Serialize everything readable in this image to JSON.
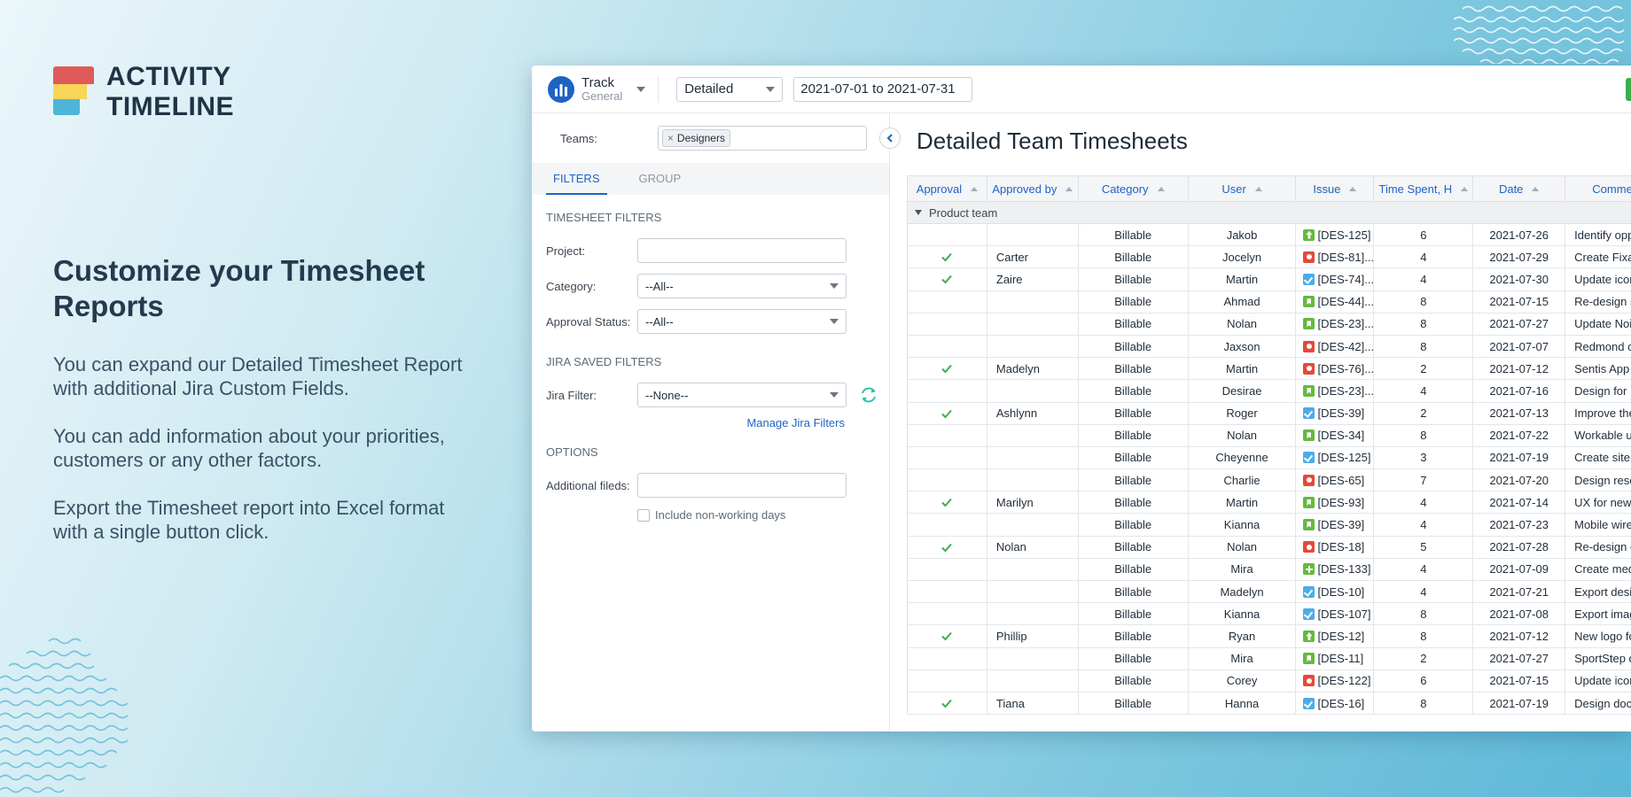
{
  "brand": {
    "line1": "ACTIVITY",
    "line2": "TIMELINE"
  },
  "headline": "Customize your Timesheet Reports",
  "paragraphs": [
    "You can expand our Detailed Timesheet Report with additional Jira Custom Fields.",
    "You can add information about your priorities, customers or any other factors.",
    "Export the Timesheet report into Excel format with a single button click."
  ],
  "app": {
    "track_title": "Track",
    "track_subtitle": "General",
    "view_select": "Detailed",
    "date_range": "2021-07-01 to 2021-07-31"
  },
  "sidebar": {
    "teams_label": "Teams:",
    "teams_chip": "Designers",
    "chip_remove": "×",
    "tabs": [
      "FILTERS",
      "GROUP"
    ],
    "timesheet_filters_title": "TIMESHEET FILTERS",
    "project_label": "Project:",
    "category_label": "Category:",
    "category_value": "--All--",
    "approval_label": "Approval Status:",
    "approval_value": "--All--",
    "jira_saved_filters_title": "JIRA SAVED FILTERS",
    "jira_filter_label": "Jira Filter:",
    "jira_filter_value": "--None--",
    "manage_link": "Manage Jira Filters",
    "options_title": "OPTIONS",
    "additional_label": "Additional fileds:",
    "include_label": "Include non-working days"
  },
  "main": {
    "title": "Detailed Team Timesheets",
    "columns": [
      "Approval",
      "Approved by",
      "Category",
      "User",
      "Issue",
      "Time Spent, H",
      "Date",
      "Comme"
    ],
    "group_name": "Product team",
    "rows": [
      {
        "approved": false,
        "by": "",
        "cat": "Billable",
        "user": "Jakob",
        "type": "improvement",
        "issue": "[DES-125]",
        "time": "6",
        "date": "2021-07-26",
        "comment": "Identify opp"
      },
      {
        "approved": true,
        "by": "Carter",
        "cat": "Billable",
        "user": "Jocelyn",
        "type": "bug",
        "issue": "[DES-81]...",
        "time": "4",
        "date": "2021-07-29",
        "comment": "Create Fixa w"
      },
      {
        "approved": true,
        "by": "Zaire",
        "cat": "Billable",
        "user": "Martin",
        "type": "task",
        "issue": "[DES-74]...",
        "time": "4",
        "date": "2021-07-30",
        "comment": "Update icon"
      },
      {
        "approved": false,
        "by": "",
        "cat": "Billable",
        "user": "Ahmad",
        "type": "story",
        "issue": "[DES-44]...",
        "time": "8",
        "date": "2021-07-15",
        "comment": "Re-design sc"
      },
      {
        "approved": false,
        "by": "",
        "cat": "Billable",
        "user": "Nolan",
        "type": "story",
        "issue": "[DES-23]...",
        "time": "8",
        "date": "2021-07-27",
        "comment": "Update Noiz"
      },
      {
        "approved": false,
        "by": "",
        "cat": "Billable",
        "user": "Jaxson",
        "type": "bug",
        "issue": "[DES-42]...",
        "time": "8",
        "date": "2021-07-07",
        "comment": "Redmond co"
      },
      {
        "approved": true,
        "by": "Madelyn",
        "cat": "Billable",
        "user": "Martin",
        "type": "bug",
        "issue": "[DES-76]...",
        "time": "2",
        "date": "2021-07-12",
        "comment": "Sentis App d"
      },
      {
        "approved": false,
        "by": "",
        "cat": "Billable",
        "user": "Desirae",
        "type": "story",
        "issue": "[DES-23]...",
        "time": "4",
        "date": "2021-07-16",
        "comment": "Design for N"
      },
      {
        "approved": true,
        "by": "Ashlynn",
        "cat": "Billable",
        "user": "Roger",
        "type": "task",
        "issue": "[DES-39]",
        "time": "2",
        "date": "2021-07-13",
        "comment": "Improve the"
      },
      {
        "approved": false,
        "by": "",
        "cat": "Billable",
        "user": "Nolan",
        "type": "story",
        "issue": "[DES-34]",
        "time": "8",
        "date": "2021-07-22",
        "comment": "Workable us"
      },
      {
        "approved": false,
        "by": "",
        "cat": "Billable",
        "user": "Cheyenne",
        "type": "task",
        "issue": "[DES-125]",
        "time": "3",
        "date": "2021-07-19",
        "comment": "Create siten"
      },
      {
        "approved": false,
        "by": "",
        "cat": "Billable",
        "user": "Charlie",
        "type": "bug",
        "issue": "[DES-65]",
        "time": "7",
        "date": "2021-07-20",
        "comment": "Design reser"
      },
      {
        "approved": true,
        "by": "Marilyn",
        "cat": "Billable",
        "user": "Martin",
        "type": "story",
        "issue": "[DES-93]",
        "time": "4",
        "date": "2021-07-14",
        "comment": "UX for new c"
      },
      {
        "approved": false,
        "by": "",
        "cat": "Billable",
        "user": "Kianna",
        "type": "story",
        "issue": "[DES-39]",
        "time": "4",
        "date": "2021-07-23",
        "comment": "Mobile wiref"
      },
      {
        "approved": true,
        "by": "Nolan",
        "cat": "Billable",
        "user": "Nolan",
        "type": "bug",
        "issue": "[DES-18]",
        "time": "5",
        "date": "2021-07-28",
        "comment": "Re-design co"
      },
      {
        "approved": false,
        "by": "",
        "cat": "Billable",
        "user": "Mira",
        "type": "newfeature",
        "issue": "[DES-133]",
        "time": "4",
        "date": "2021-07-09",
        "comment": "Create medi"
      },
      {
        "approved": false,
        "by": "",
        "cat": "Billable",
        "user": "Madelyn",
        "type": "task",
        "issue": "[DES-10]",
        "time": "4",
        "date": "2021-07-21",
        "comment": "Export desig"
      },
      {
        "approved": false,
        "by": "",
        "cat": "Billable",
        "user": "Kianna",
        "type": "task",
        "issue": "[DES-107]",
        "time": "8",
        "date": "2021-07-08",
        "comment": "Export imag"
      },
      {
        "approved": true,
        "by": "Phillip",
        "cat": "Billable",
        "user": "Ryan",
        "type": "improvement",
        "issue": "[DES-12]",
        "time": "8",
        "date": "2021-07-12",
        "comment": "New logo fo"
      },
      {
        "approved": false,
        "by": "",
        "cat": "Billable",
        "user": "Mira",
        "type": "story",
        "issue": "[DES-11]",
        "time": "2",
        "date": "2021-07-27",
        "comment": "SportStep de"
      },
      {
        "approved": false,
        "by": "",
        "cat": "Billable",
        "user": "Corey",
        "type": "bug",
        "issue": "[DES-122]",
        "time": "6",
        "date": "2021-07-15",
        "comment": "Update icon"
      },
      {
        "approved": true,
        "by": "Tiana",
        "cat": "Billable",
        "user": "Hanna",
        "type": "task",
        "issue": "[DES-16]",
        "time": "8",
        "date": "2021-07-19",
        "comment": "Design docu"
      }
    ]
  },
  "colors": {
    "accent": "#1e63c4",
    "approve_check": "#3fae4a",
    "export_button": "#3fae4a"
  }
}
